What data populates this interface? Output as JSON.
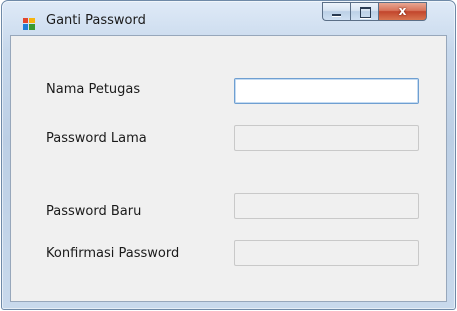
{
  "window": {
    "title": "Ganti Password",
    "icon": "app-window-icon",
    "controls": {
      "minimize": "minimize-icon",
      "maximize": "maximize-icon",
      "close_glyph": "x"
    }
  },
  "form": {
    "nama_petugas": {
      "label": "Nama Petugas",
      "value": "",
      "enabled": true
    },
    "password_lama": {
      "label": "Password Lama",
      "value": "",
      "enabled": false
    },
    "password_baru": {
      "label": "Password Baru",
      "value": "",
      "enabled": false
    },
    "konfirmasi_password": {
      "label": "Konfirmasi Password",
      "value": "",
      "enabled": false
    }
  },
  "colors": {
    "close_button": "#c2452c",
    "focused_border": "#6f9fd1",
    "client_background": "#f0f0f0"
  }
}
